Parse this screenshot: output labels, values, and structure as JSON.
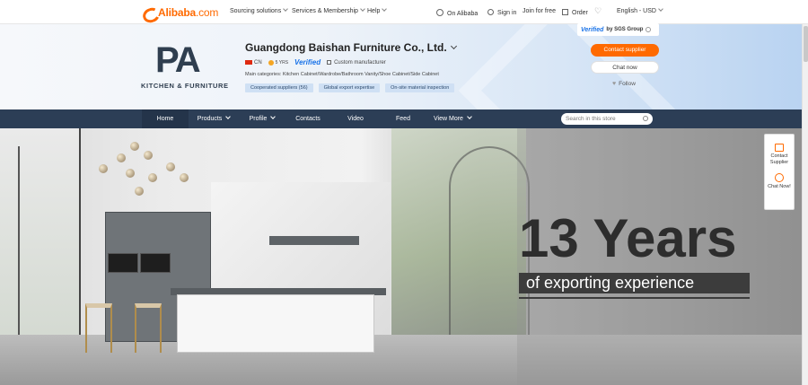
{
  "topnav": {
    "logo_brand": "Alibaba",
    "logo_domain": ".com",
    "sourcing": "Sourcing solutions",
    "services": "Services & Membership",
    "help": "Help",
    "on_alibaba": "On Alibaba",
    "signin": "Sign in",
    "join": "Join for free",
    "order": "Order",
    "lang": "English - USD"
  },
  "company": {
    "logo_letters": "PA",
    "logo_sub": "KITCHEN & FURNITURE",
    "name": "Guangdong Baishan Furniture Co., Ltd.",
    "country": "CN",
    "years": "5 YRS",
    "verified": "Verified",
    "type": "Custom manufacturer",
    "main_categories": "Main categories: Kitchen Cabinet/Wardrobe/Bathroom Vanity/Shoe Cabinet/Side Cabinet",
    "tags": [
      "Cooperated suppliers (56)",
      "Global export expertise",
      "On-site material inspection"
    ]
  },
  "sgs": {
    "verified": "Verified",
    "by": "by SGS Group"
  },
  "actions": {
    "contact": "Contact supplier",
    "chat": "Chat now",
    "follow": "Follow"
  },
  "storenav": {
    "items": [
      "Home",
      "Products",
      "Profile",
      "Contacts",
      "Video",
      "Feed",
      "View More"
    ],
    "search_placeholder": "Search in this store"
  },
  "banner": {
    "headline": "13 Years",
    "subline": "of exporting experience"
  },
  "float_panel": {
    "contact": "Contact Supplier",
    "chat": "Chat Now!"
  },
  "colors": {
    "accent": "#ff6a00",
    "nav_bg": "#2c3e56",
    "verified_blue": "#1a73e8"
  }
}
